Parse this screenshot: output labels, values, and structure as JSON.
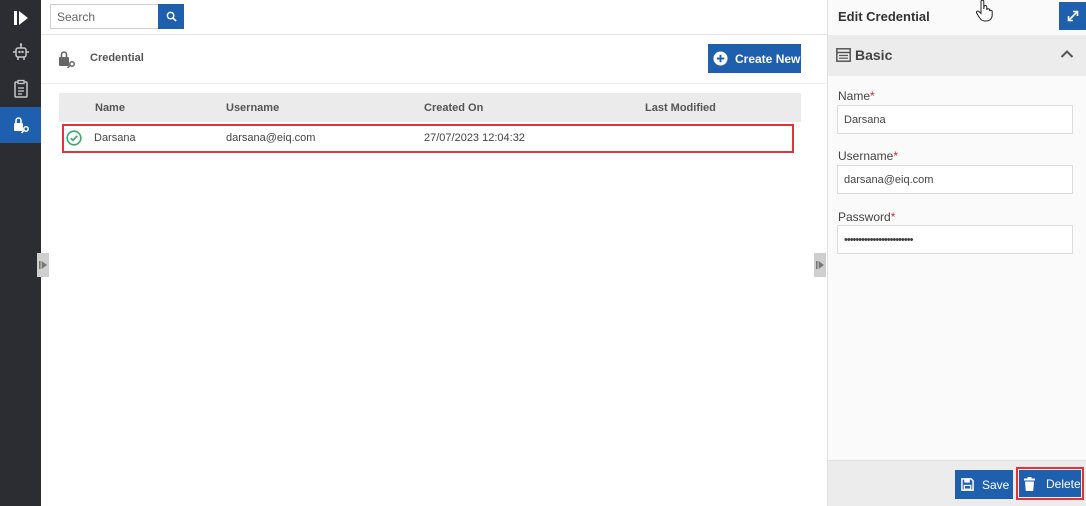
{
  "search": {
    "placeholder": "Search"
  },
  "page": {
    "title": "Credential",
    "create_label": "Create New"
  },
  "table": {
    "columns": [
      "Name",
      "Username",
      "Created On",
      "Last Modified"
    ],
    "rows": [
      {
        "name": "Darsana",
        "username": "darsana@eiq.com",
        "created_on": "27/07/2023 12:04:32",
        "last_modified": ""
      }
    ]
  },
  "panel": {
    "title": "Edit Credential",
    "section": "Basic",
    "fields": {
      "name": {
        "label": "Name",
        "value": "Darsana"
      },
      "username": {
        "label": "Username",
        "value": "darsana@eiq.com"
      },
      "password": {
        "label": "Password",
        "value": "••••••••••••••••••••••••"
      }
    },
    "required_mark": "*",
    "save_label": "Save",
    "delete_label": "Delete"
  },
  "colors": {
    "accent": "#1e5fae",
    "rail": "#2b2d33",
    "highlight": "#e0333b",
    "success": "#3aa76d"
  }
}
